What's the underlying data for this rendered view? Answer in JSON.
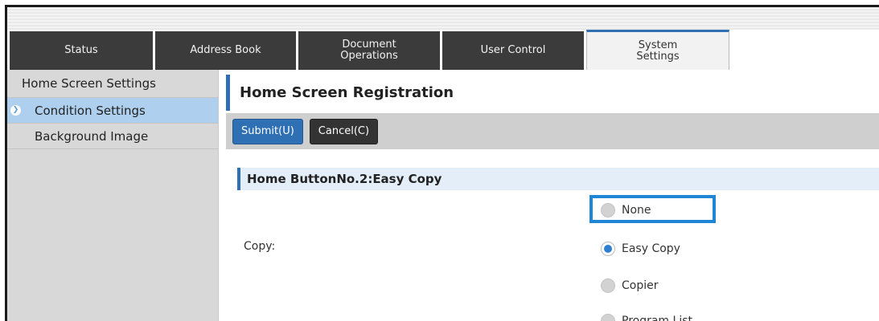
{
  "tabs": [
    {
      "label": "Status"
    },
    {
      "label": "Address Book"
    },
    {
      "label": "Document\nOperations"
    },
    {
      "label": "User Control"
    },
    {
      "label": "System\nSettings"
    }
  ],
  "sidebar": {
    "header": "Home Screen Settings",
    "items": [
      {
        "label": "Condition Settings",
        "selected": true
      },
      {
        "label": "Background Image",
        "selected": false
      }
    ]
  },
  "main": {
    "title": "Home Screen Registration",
    "buttons": {
      "submit": "Submit(U)",
      "cancel": "Cancel(C)"
    },
    "section_title": "Home ButtonNo.2:Easy Copy",
    "field_label": "Copy:",
    "options": [
      {
        "label": "None",
        "checked": false
      },
      {
        "label": "Easy Copy",
        "checked": true
      },
      {
        "label": "Copier",
        "checked": false
      },
      {
        "label": "Program List",
        "checked": false
      }
    ]
  },
  "colors": {
    "accent": "#2f6fb3",
    "highlight": "#1f86d6",
    "selected_row": "#aed0ee"
  }
}
